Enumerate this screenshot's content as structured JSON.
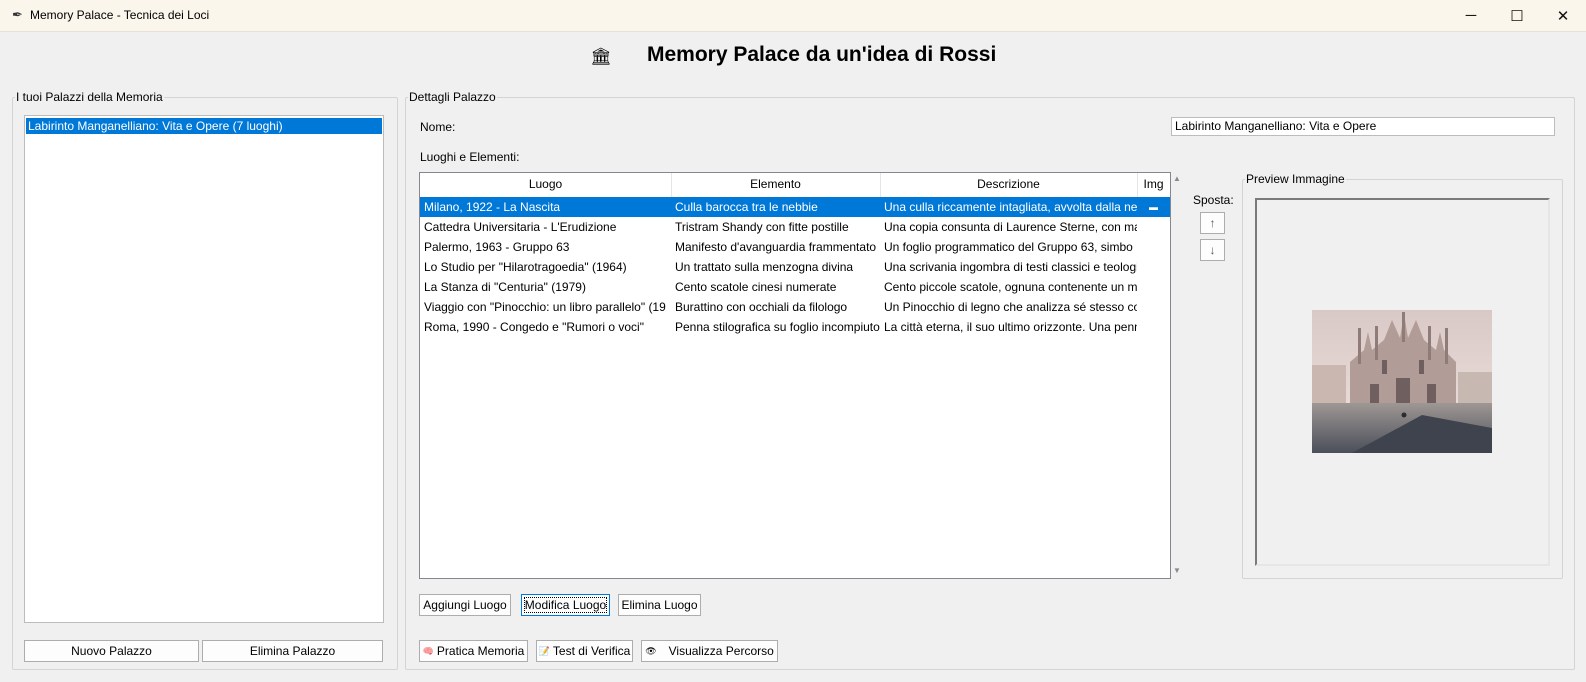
{
  "window": {
    "title": "Memory Palace - Tecnica dei Loci",
    "app_icon": "feather-icon",
    "controls": {
      "minimize": "─",
      "maximize": "☐",
      "close": "✕"
    }
  },
  "header": {
    "icon": "classical-building-icon",
    "icon_glyph": "🏛",
    "title": "Memory Palace da un'idea di Rossi"
  },
  "palaces_panel": {
    "legend": "I tuoi Palazzi della Memoria",
    "items": [
      {
        "label": "Labirinto Manganelliano: Vita e Opere (7 luoghi)",
        "selected": true
      }
    ],
    "new_button": "Nuovo Palazzo",
    "delete_button": "Elimina Palazzo"
  },
  "details_panel": {
    "legend": "Dettagli Palazzo",
    "name_label": "Nome:",
    "name_value": "Labirinto Manganelliano: Vita e Opere",
    "places_label": "Luoghi e Elementi:",
    "table": {
      "columns": [
        "Luogo",
        "Elemento",
        "Descrizione",
        "Img"
      ],
      "rows": [
        {
          "luogo": "Milano, 1922 - La Nascita",
          "elemento": "Culla barocca tra le nebbie",
          "descrizione": "Una culla riccamente intagliata, avvolta dalla ne",
          "img": "▬",
          "selected": true
        },
        {
          "luogo": "Cattedra Universitaria - L'Erudizione",
          "elemento": "Tristram Shandy con fitte postille",
          "descrizione": "Una copia consunta di Laurence Sterne, con ma",
          "img": ""
        },
        {
          "luogo": "Palermo, 1963 - Gruppo 63",
          "elemento": "Manifesto d'avanguardia frammentato",
          "descrizione": "Un foglio programmatico del Gruppo 63, simbo",
          "img": ""
        },
        {
          "luogo": "Lo Studio per \"Hilarotragoedia\" (1964)",
          "elemento": "Un trattato sulla menzogna divina",
          "descrizione": "Una scrivania ingombra di testi classici e teologi",
          "img": ""
        },
        {
          "luogo": "La Stanza di \"Centuria\" (1979)",
          "elemento": "Cento scatole cinesi numerate",
          "descrizione": "Cento piccole scatole, ognuna contenente un m",
          "img": ""
        },
        {
          "luogo": "Viaggio con \"Pinocchio: un libro parallelo\" (19",
          "elemento": "Burattino con occhiali da filologo",
          "descrizione": "Un Pinocchio di legno che analizza sé stesso cor",
          "img": ""
        },
        {
          "luogo": "Roma, 1990 - Congedo e \"Rumori o voci\"",
          "elemento": "Penna stilografica su foglio incompiuto",
          "descrizione": "La città eterna, il suo ultimo orizzonte. Una penn",
          "img": ""
        }
      ]
    },
    "move": {
      "label": "Sposta:",
      "up": "↑",
      "down": "↓"
    },
    "preview": {
      "legend": "Preview Immagine"
    },
    "actions": {
      "add": "Aggiungi Luogo",
      "edit": "Modifica Luogo",
      "delete": "Elimina Luogo"
    },
    "modes": {
      "practice": {
        "label": "Pratica Memoria",
        "icon": "brain-icon",
        "glyph": "🧠"
      },
      "test": {
        "label": "Test di Verifica",
        "icon": "test-icon",
        "glyph": "📝"
      },
      "path": {
        "label": "Visualizza Percorso",
        "icon": "eye-icon",
        "glyph": "👁"
      }
    }
  }
}
